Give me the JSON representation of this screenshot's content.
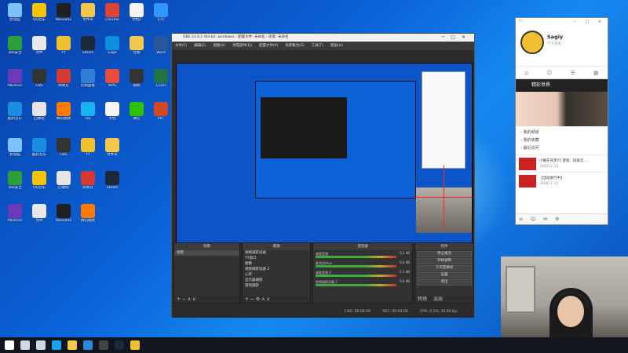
{
  "desktop_icons": [
    {
      "label": "此电脑",
      "color": "#7cc2ff"
    },
    {
      "label": "360安全",
      "color": "#2a9f3a"
    },
    {
      "label": "Mkvtool",
      "color": "#6a3ab8"
    },
    {
      "label": "酷狗音乐",
      "color": "#1a8de0"
    },
    {
      "label": "QQ音乐",
      "color": "#f5c400"
    },
    {
      "label": "文件",
      "color": "#e8e8e8"
    },
    {
      "label": "OBS",
      "color": "#333333"
    },
    {
      "label": "回收站",
      "color": "#e6e6e6"
    },
    {
      "label": "WeGame",
      "color": "#202020"
    },
    {
      "label": "YY",
      "color": "#f0c030"
    },
    {
      "label": "网易云",
      "color": "#d33a31"
    },
    {
      "label": "腾讯视频",
      "color": "#ff7a00"
    },
    {
      "label": "文件夹",
      "color": "#f2c94c"
    },
    {
      "label": "Steam",
      "color": "#1b2838"
    },
    {
      "label": "控制面板",
      "color": "#2f7fd8"
    },
    {
      "label": "QQ",
      "color": "#1ab2f0"
    },
    {
      "label": "Chrome",
      "color": "#db4437"
    },
    {
      "label": "Edge",
      "color": "#0f8fe0"
    },
    {
      "label": "WPS",
      "color": "#e74c3c"
    },
    {
      "label": "文档",
      "color": "#f5f5f5"
    },
    {
      "label": "文档2",
      "color": "#f5f5f5"
    },
    {
      "label": "音频",
      "color": "#f2c94c"
    },
    {
      "label": "视频",
      "color": "#333333"
    },
    {
      "label": "微信",
      "color": "#2dc100"
    },
    {
      "label": "钉钉",
      "color": "#3296fa"
    },
    {
      "label": "Word",
      "color": "#2b579a"
    },
    {
      "label": "Excel",
      "color": "#217346"
    },
    {
      "label": "PPT",
      "color": "#d24726"
    }
  ],
  "obs": {
    "title": "OBS 23.0.2 (64-bit, windows) - 配置文件: 未命名 - 场景: 未命名",
    "menu": [
      "文件(F)",
      "编辑(E)",
      "视图(V)",
      "停靠部件(D)",
      "配置文件(P)",
      "场景集合(S)",
      "工具(T)",
      "帮助(H)"
    ],
    "docks": {
      "scenes_title": "场景",
      "scenes": [
        "场景"
      ],
      "sources_title": "来源",
      "sources": [
        "视频捕获设备",
        "YY窗口",
        "图像",
        "视频捕获设备 2",
        "心率",
        "显示器捕获",
        "游戏捕获"
      ],
      "mixer_title": "混音器",
      "mixer": [
        {
          "name": "桌面音频",
          "db": "-3.2 dB"
        },
        {
          "name": "麦克风/Aux",
          "db": "0.0 dB"
        },
        {
          "name": "桌面音频 2",
          "db": "-1.1 dB"
        },
        {
          "name": "视频捕获设备 2",
          "db": "0.0 dB"
        }
      ],
      "transition_title": "转场",
      "transition_value": "淡出",
      "controls_title": "控件",
      "controls": [
        "停止推流",
        "开始录制",
        "工作室模式",
        "设置",
        "退出"
      ]
    },
    "status": {
      "live": "LIVE: 00:00:00",
      "rec": "REC: 00:00:00",
      "cpu": "CPU: 0.1%, 30.00 fps"
    }
  },
  "yy": {
    "brand": "YY",
    "user_name": "Sagiy",
    "user_sub": "个人签名",
    "window_controls": "─ □ ✕",
    "banner": "精彩世界",
    "list": [
      "我的频道",
      "我的收藏",
      "最近访问"
    ],
    "rooms": [
      {
        "title": "小静在开黑YY 游戏、同屏云 ...",
        "meta": "348511  15"
      },
      {
        "title": "【活动进行中】",
        "meta": "348871  15"
      }
    ],
    "bottom": "≡ ☺ ✉ ⚙"
  },
  "taskbar": {
    "items": [
      {
        "name": "start",
        "color": "#ffffff"
      },
      {
        "name": "search",
        "color": "#cfd6e4"
      },
      {
        "name": "taskview",
        "color": "#cfd6e4"
      },
      {
        "name": "edge",
        "color": "#1da1f2"
      },
      {
        "name": "explorer",
        "color": "#f2c94c"
      },
      {
        "name": "store",
        "color": "#2b88d8"
      },
      {
        "name": "obs",
        "color": "#444444"
      },
      {
        "name": "steam",
        "color": "#1b2838"
      },
      {
        "name": "yy",
        "color": "#f0c030"
      }
    ]
  }
}
